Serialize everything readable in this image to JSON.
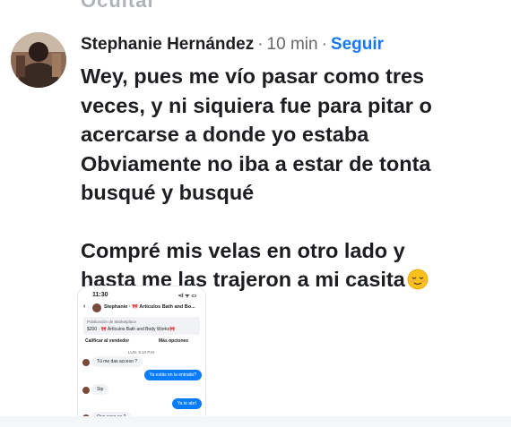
{
  "top_fragment": "Ocultar",
  "comment": {
    "author": "Stephanie Hernández",
    "separator": "·",
    "time": "10 min",
    "follow_label": "Seguir",
    "paragraph1_lines": [
      "Wey, pues me vío pasar como tres",
      "veces, y ni siquiera fue para pitar o",
      "acercarse a donde yo estaba",
      "Obviamente no iba a estar de tonta",
      "busqué y busqué"
    ],
    "paragraph2_lines": [
      "Compré mis velas en otro lado y",
      "hasta me las trajeron a mi casita"
    ],
    "emoji": "relieved-face"
  },
  "screenshot": {
    "status_time": "11:30",
    "status_icons": "•ıl ᯤ ▭",
    "back": "‹",
    "thread_title": "Stephanie · 🎀 Artículos Bath and Bo...",
    "listing_label": "Publicación de Marketplace",
    "listing_item": "$200 · 🎀 Artículos Bath and Body Works🎀",
    "action_rate": "Calificar al vendedor",
    "action_more": "Más opciones",
    "date": "LUN, 9:10 P.M.",
    "messages": [
      {
        "side": "in",
        "text": "Tú me das acceso ?"
      },
      {
        "side": "out",
        "text": "Ya estás en la entrada?"
      },
      {
        "side": "in",
        "text": "Sip"
      },
      {
        "side": "out",
        "text": "Ya te abrí"
      },
      {
        "side": "in",
        "text": "Que casa es ?"
      }
    ]
  },
  "colors": {
    "text": "#1c1e21",
    "muted": "#65676b",
    "link": "#1877f2",
    "bubble_out": "#0a7cff"
  }
}
